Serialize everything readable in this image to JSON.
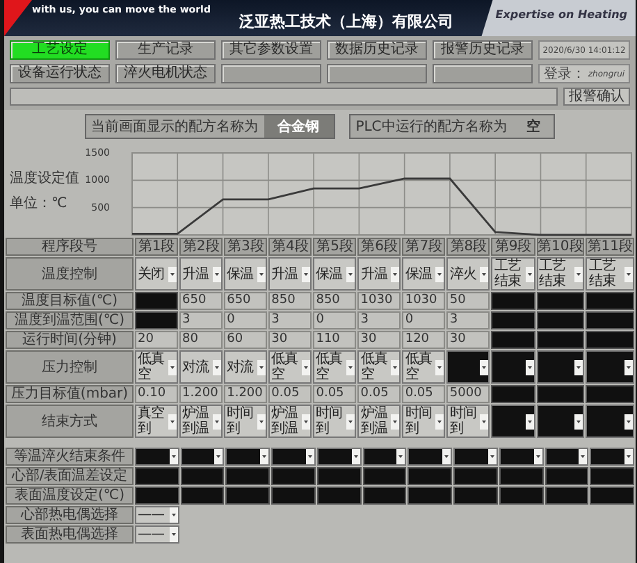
{
  "header": {
    "slogan": "with us, you can move the world",
    "company": "泛亚热工技术（上海）有限公司",
    "tagline": "Expertise on Heating"
  },
  "nav_rows": [
    [
      {
        "label": "工艺设定",
        "selected": true
      },
      {
        "label": "生产记录",
        "selected": false
      },
      {
        "label": "其它参数设置",
        "selected": false
      },
      {
        "label": "数据历史记录",
        "selected": false
      },
      {
        "label": "报警历史记录",
        "selected": false
      }
    ],
    [
      {
        "label": "设备运行状态",
        "selected": false
      },
      {
        "label": "淬火电机状态",
        "selected": false
      },
      {
        "selected": false
      },
      {
        "selected": false
      },
      {
        "selected": false
      }
    ]
  ],
  "datetime": "2020/6/30 14:01:12",
  "login": {
    "label": "登录：",
    "user": "zhongrui"
  },
  "ack_button": "报警确认",
  "recipe": [
    {
      "label": "当前画面显示的配方名称为",
      "value": "合金钢"
    },
    {
      "label": "PLC中运行的配方名称为",
      "value": "空"
    }
  ],
  "chart": {
    "unit_label": "单位：℃",
    "chart_data": {
      "type": "line",
      "grid": true,
      "ylabel": "温度设定值",
      "ylim": [
        0,
        1500
      ],
      "yticks": [
        500,
        1000,
        1500
      ],
      "series": [
        {
          "color": "#3a3a3a",
          "values": [
            20,
            20,
            650,
            650,
            850,
            850,
            1030,
            1030,
            50,
            0,
            0,
            0
          ]
        }
      ]
    }
  },
  "program_table": {
    "header": "程序段号",
    "segments": [
      "第1段",
      "第2段",
      "第3段",
      "第4段",
      "第5段",
      "第6段",
      "第7段",
      "第8段",
      "第9段",
      "第10段",
      "第11段"
    ],
    "rows": [
      {
        "label": "温度控制",
        "cells": [
          {
            "kind": "select",
            "value": "关闭"
          },
          {
            "kind": "select",
            "value": "升温"
          },
          {
            "kind": "select",
            "value": "保温"
          },
          {
            "kind": "select",
            "value": "升温"
          },
          {
            "kind": "select",
            "value": "保温"
          },
          {
            "kind": "select",
            "value": "升温"
          },
          {
            "kind": "select",
            "value": "保温"
          },
          {
            "kind": "select",
            "value": "淬火"
          },
          {
            "kind": "select",
            "value": "工艺结束"
          },
          {
            "kind": "select",
            "value": "工艺结束"
          },
          {
            "kind": "select",
            "value": "工艺结束"
          }
        ]
      },
      {
        "label": "温度目标值(℃)",
        "cells": [
          {
            "kind": "off"
          },
          {
            "kind": "text",
            "value": "650"
          },
          {
            "kind": "text",
            "value": "650"
          },
          {
            "kind": "text",
            "value": "850"
          },
          {
            "kind": "text",
            "value": "850"
          },
          {
            "kind": "text",
            "value": "1030"
          },
          {
            "kind": "text",
            "value": "1030"
          },
          {
            "kind": "text",
            "value": "50"
          },
          {
            "kind": "off"
          },
          {
            "kind": "off"
          },
          {
            "kind": "off"
          }
        ]
      },
      {
        "label": "温度到温范围(℃)",
        "cells": [
          {
            "kind": "off"
          },
          {
            "kind": "text",
            "value": "3"
          },
          {
            "kind": "text",
            "value": "0"
          },
          {
            "kind": "text",
            "value": "3"
          },
          {
            "kind": "text",
            "value": "0"
          },
          {
            "kind": "text",
            "value": "3"
          },
          {
            "kind": "text",
            "value": "0"
          },
          {
            "kind": "text",
            "value": "3"
          },
          {
            "kind": "off"
          },
          {
            "kind": "off"
          },
          {
            "kind": "off"
          }
        ]
      },
      {
        "label": "运行时间(分钟)",
        "cells": [
          {
            "kind": "text",
            "value": "20"
          },
          {
            "kind": "text",
            "value": "80"
          },
          {
            "kind": "text",
            "value": "60"
          },
          {
            "kind": "text",
            "value": "30"
          },
          {
            "kind": "text",
            "value": "110"
          },
          {
            "kind": "text",
            "value": "30"
          },
          {
            "kind": "text",
            "value": "120"
          },
          {
            "kind": "text",
            "value": "30"
          },
          {
            "kind": "off"
          },
          {
            "kind": "off"
          },
          {
            "kind": "off"
          }
        ]
      },
      {
        "label": "压力控制",
        "cells": [
          {
            "kind": "select",
            "value": "低真空"
          },
          {
            "kind": "select",
            "value": "对流"
          },
          {
            "kind": "select",
            "value": "对流"
          },
          {
            "kind": "select",
            "value": "低真空"
          },
          {
            "kind": "select",
            "value": "低真空"
          },
          {
            "kind": "select",
            "value": "低真空"
          },
          {
            "kind": "select",
            "value": "低真空"
          },
          {
            "kind": "off_select"
          },
          {
            "kind": "off_select"
          },
          {
            "kind": "off_select"
          },
          {
            "kind": "off_select"
          }
        ]
      },
      {
        "label": "压力目标值(mbar)",
        "cells": [
          {
            "kind": "text",
            "value": "0.10"
          },
          {
            "kind": "text",
            "value": "1.200"
          },
          {
            "kind": "text",
            "value": "1.200"
          },
          {
            "kind": "text",
            "value": "0.05"
          },
          {
            "kind": "text",
            "value": "0.05"
          },
          {
            "kind": "text",
            "value": "0.05"
          },
          {
            "kind": "text",
            "value": "0.05"
          },
          {
            "kind": "text",
            "value": "5000"
          },
          {
            "kind": "off"
          },
          {
            "kind": "off"
          },
          {
            "kind": "off"
          }
        ]
      },
      {
        "label": "结束方式",
        "cells": [
          {
            "kind": "select",
            "value": "真空到"
          },
          {
            "kind": "select",
            "value": "炉温到温"
          },
          {
            "kind": "select",
            "value": "时间到"
          },
          {
            "kind": "select",
            "value": "炉温到温"
          },
          {
            "kind": "select",
            "value": "时间到"
          },
          {
            "kind": "select",
            "value": "炉温到温"
          },
          {
            "kind": "select",
            "value": "时间到"
          },
          {
            "kind": "select",
            "value": "时间到"
          },
          {
            "kind": "off_select"
          },
          {
            "kind": "off_select"
          },
          {
            "kind": "off_select"
          }
        ]
      }
    ]
  },
  "quench_table": {
    "rows": [
      {
        "label": "等温淬火结束条件",
        "cells": [
          {
            "kind": "off_select"
          },
          {
            "kind": "off_select"
          },
          {
            "kind": "off_select"
          },
          {
            "kind": "off_select"
          },
          {
            "kind": "off_select"
          },
          {
            "kind": "off_select"
          },
          {
            "kind": "off_select"
          },
          {
            "kind": "off_select"
          },
          {
            "kind": "off_select"
          },
          {
            "kind": "off_select"
          },
          {
            "kind": "off_select"
          }
        ]
      },
      {
        "label": "心部/表面温差设定",
        "cells": [
          {
            "kind": "off"
          },
          {
            "kind": "off"
          },
          {
            "kind": "off"
          },
          {
            "kind": "off"
          },
          {
            "kind": "off"
          },
          {
            "kind": "off"
          },
          {
            "kind": "off"
          },
          {
            "kind": "off"
          },
          {
            "kind": "off"
          },
          {
            "kind": "off"
          },
          {
            "kind": "off"
          }
        ]
      },
      {
        "label": "表面温度设定(℃)",
        "cells": [
          {
            "kind": "off"
          },
          {
            "kind": "off"
          },
          {
            "kind": "off"
          },
          {
            "kind": "off"
          },
          {
            "kind": "off"
          },
          {
            "kind": "off"
          },
          {
            "kind": "off"
          },
          {
            "kind": "off"
          },
          {
            "kind": "off"
          },
          {
            "kind": "off"
          },
          {
            "kind": "off"
          }
        ]
      },
      {
        "label": "心部热电偶选择",
        "cells": [
          {
            "kind": "select",
            "value": "——"
          }
        ]
      },
      {
        "label": "表面热电偶选择",
        "cells": [
          {
            "kind": "select",
            "value": "——"
          }
        ]
      }
    ]
  }
}
